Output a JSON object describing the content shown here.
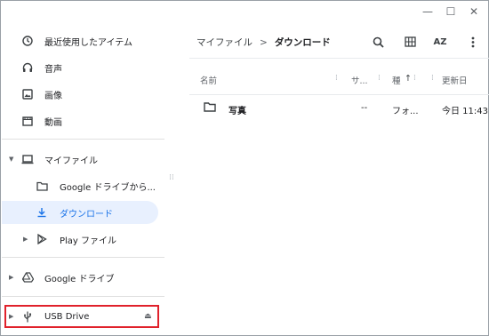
{
  "window": {
    "minimize_label": "—",
    "maximize_label": "☐",
    "close_label": "✕"
  },
  "sidebar": {
    "recent": "最近使用したアイテム",
    "audio": "音声",
    "images": "画像",
    "videos": "動画",
    "my_files": "マイファイル",
    "google_drive_folder": "Google ドライブから...",
    "downloads": "ダウンロード",
    "play_files": "Play ファイル",
    "google_drive": "Google ドライブ",
    "usb_drive": "USB Drive"
  },
  "breadcrumb": {
    "root": "マイファイル",
    "separator": ">",
    "current": "ダウンロード"
  },
  "toolbar": {
    "sort_label": "AZ"
  },
  "columns": {
    "name": "名前",
    "size": "サ...",
    "type": "種",
    "modified": "更新日"
  },
  "files": [
    {
      "name": "写真",
      "size": "--",
      "type": "フォ...",
      "modified": "今日 11:43"
    }
  ],
  "icons": {
    "recent": "clock-icon",
    "audio": "headphones-icon",
    "images": "image-icon",
    "videos": "film-icon",
    "my_files": "laptop-icon",
    "folder": "folder-icon",
    "downloads": "download-icon",
    "play": "play-store-icon",
    "drive": "google-drive-icon",
    "usb": "usb-icon",
    "eject": "eject-icon",
    "search": "search-icon",
    "grid": "grid-view-icon",
    "more": "more-vert-icon"
  },
  "colors": {
    "accent": "#1a73e8",
    "selected_bg": "#e8f0fe",
    "highlight_border": "#e0212b"
  }
}
